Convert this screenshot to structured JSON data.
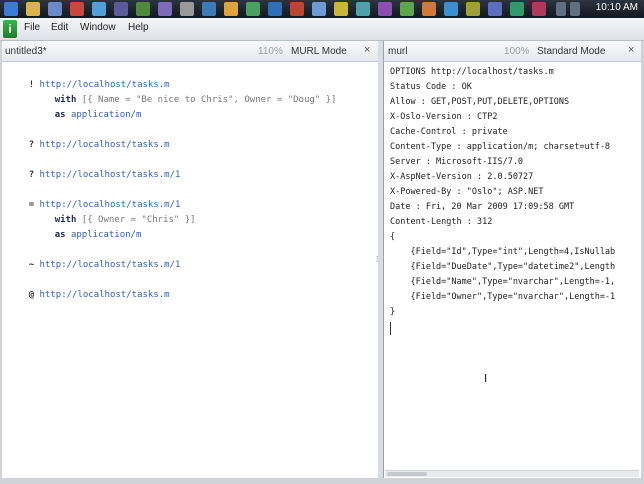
{
  "taskbar": {
    "clock": "10:10 AM"
  },
  "menubar": {
    "logo": "i",
    "items": [
      "File",
      "Edit",
      "Window",
      "Help"
    ]
  },
  "left_pane": {
    "title": "untitled3*",
    "zoom": "110%",
    "mode": "MURL Mode",
    "close": "×",
    "lines": [
      {
        "sym": "!",
        "url": "http://localhost/tasks.m"
      },
      {
        "kw": "with",
        "literal": "[{ Name = \"Be nice to Chris\", Owner = \"Doug\" }]"
      },
      {
        "kw": "as",
        "mime": "application/m"
      },
      {
        "sym": "?",
        "url": "http://localhost/tasks.m"
      },
      {
        "sym": "?",
        "url": "http://localhost/tasks.m/1"
      },
      {
        "sym": "=",
        "url": "http://localhost/tasks.m/1"
      },
      {
        "kw": "with",
        "literal": "[{ Owner = \"Chris\" }]"
      },
      {
        "kw": "as",
        "mime": "application/m"
      },
      {
        "sym": "~",
        "url": "http://localhost/tasks.m/1"
      },
      {
        "sym": "@",
        "url": "http://localhost/tasks.m"
      }
    ]
  },
  "right_pane": {
    "title": "murl",
    "zoom": "100%",
    "mode": "Standard Mode",
    "close": "×",
    "lines": [
      "OPTIONS http://localhost/tasks.m",
      "Status Code : OK",
      "Allow : GET,POST,PUT,DELETE,OPTIONS",
      "X-Oslo-Version : CTP2",
      "Cache-Control : private",
      "Content-Type : application/m; charset=utf-8",
      "Server : Microsoft-IIS/7.0",
      "X-AspNet-Version : 2.0.50727",
      "X-Powered-By : \"Oslo\"; ASP.NET",
      "Date : Fri, 20 Mar 2009 17:09:58 GMT",
      "Content-Length : 312",
      "{",
      "    {Field=\"Id\",Type=\"int\",Length=4,IsNullab",
      "    {Field=\"DueDate\",Type=\"datetime2\",Length",
      "    {Field=\"Name\",Type=\"nvarchar\",Length=-1,",
      "    {Field=\"Owner\",Type=\"nvarchar\",Length=-1",
      "}"
    ]
  },
  "splitter": {
    "grip": "⁞"
  },
  "cursor": {
    "ibeam": "I"
  },
  "colors": {
    "url": "#2f5fc4",
    "keyword": "#1a2a55",
    "literal": "#777777"
  }
}
